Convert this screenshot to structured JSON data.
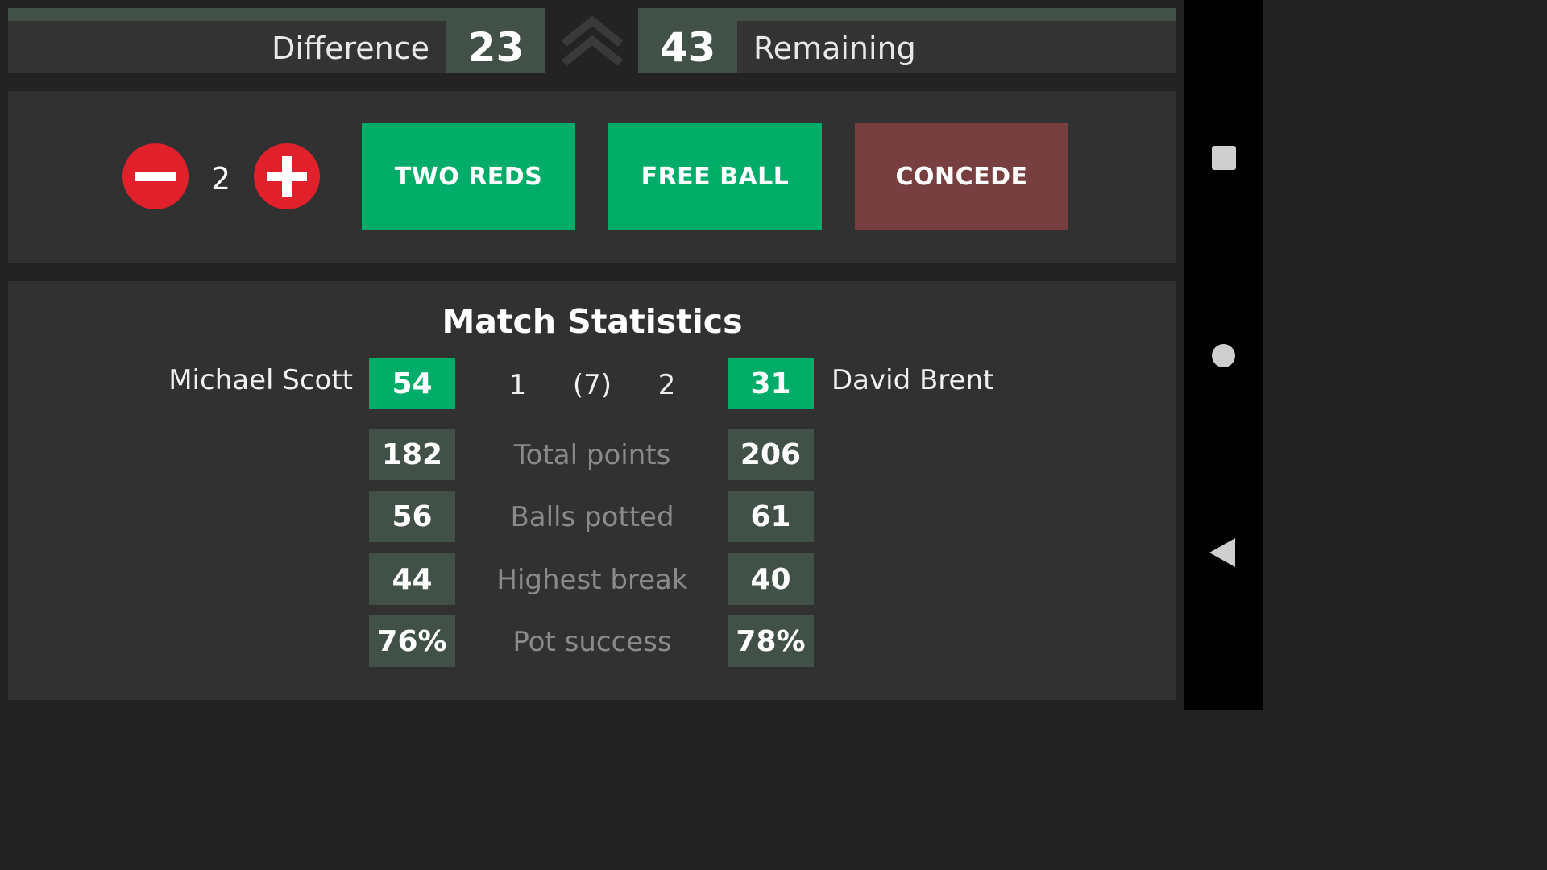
{
  "scoreboard": {
    "difference_label": "Difference",
    "difference_value": "23",
    "remaining_value": "43",
    "remaining_label": "Remaining",
    "expand_icon": "double-chevron-up-icon"
  },
  "controls": {
    "minus_icon": "minus-icon",
    "plus_icon": "plus-icon",
    "count": "2",
    "two_reds_label": "TWO REDS",
    "free_ball_label": "FREE BALL",
    "concede_label": "CONCEDE"
  },
  "colors": {
    "background": "#232323",
    "panel": "#313131",
    "accent_green": "#00ad68",
    "stat_box": "#425148",
    "concede": "#773f3f",
    "round_button_red": "#e0202a"
  },
  "stats": {
    "title": "Match Statistics",
    "player1": {
      "name": "Michael Scott",
      "score": "54"
    },
    "player2": {
      "name": "David Brent",
      "score": "31"
    },
    "frames": {
      "p1": "1",
      "total": "(7)",
      "p2": "2"
    },
    "rows": [
      {
        "label": "Total points",
        "p1": "182",
        "p2": "206"
      },
      {
        "label": "Balls potted",
        "p1": "56",
        "p2": "61"
      },
      {
        "label": "Highest break",
        "p1": "44",
        "p2": "40"
      },
      {
        "label": "Pot success",
        "p1": "76%",
        "p2": "78%"
      }
    ]
  },
  "navigation": {
    "recents_icon": "square-icon",
    "home_icon": "circle-icon",
    "back_icon": "back-triangle-icon"
  }
}
